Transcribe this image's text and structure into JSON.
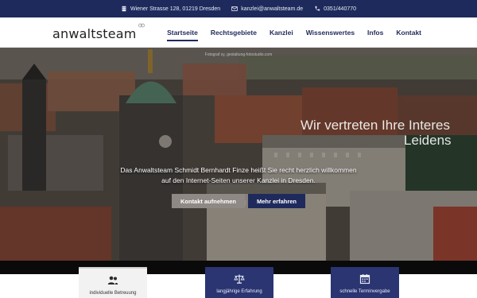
{
  "topbar": {
    "address": "Wiener Strasse 128, 01219 Dresden",
    "email": "kanzlei@anwaltsteam.de",
    "phone": "0351/440770"
  },
  "header": {
    "logo": "anwaltsteam",
    "nav": [
      "Startseite",
      "Rechtsgebiete",
      "Kanzlei",
      "Wissenswertes",
      "Infos",
      "Kontakt"
    ],
    "active_nav": "Startseite"
  },
  "hero": {
    "credit": "Fotograf xy, gestaltung-fotostudio.com",
    "claim_line1": "Wir vertreten Ihre Interes",
    "claim_line2": "Leidens",
    "welcome_line1": "Das Anwaltsteam Schmidt Bernhardt Finze heißt Sie recht herzlich willkommen",
    "welcome_line2": "auf den Internet-Seiten unserer Kanzlei in Dresden.",
    "btn_contact": "Kontakt aufnehmen",
    "btn_more": "Mehr erfahren"
  },
  "features": [
    {
      "label": "individuelle Betreuung",
      "icon": "users-icon"
    },
    {
      "label": "langjährige Erfahrung",
      "icon": "scales-icon"
    },
    {
      "label": "schnelle Terminvergabe",
      "icon": "calendar-icon"
    }
  ],
  "colors": {
    "brand": "#1f2a5c",
    "accent_gray": "#8e8984"
  }
}
